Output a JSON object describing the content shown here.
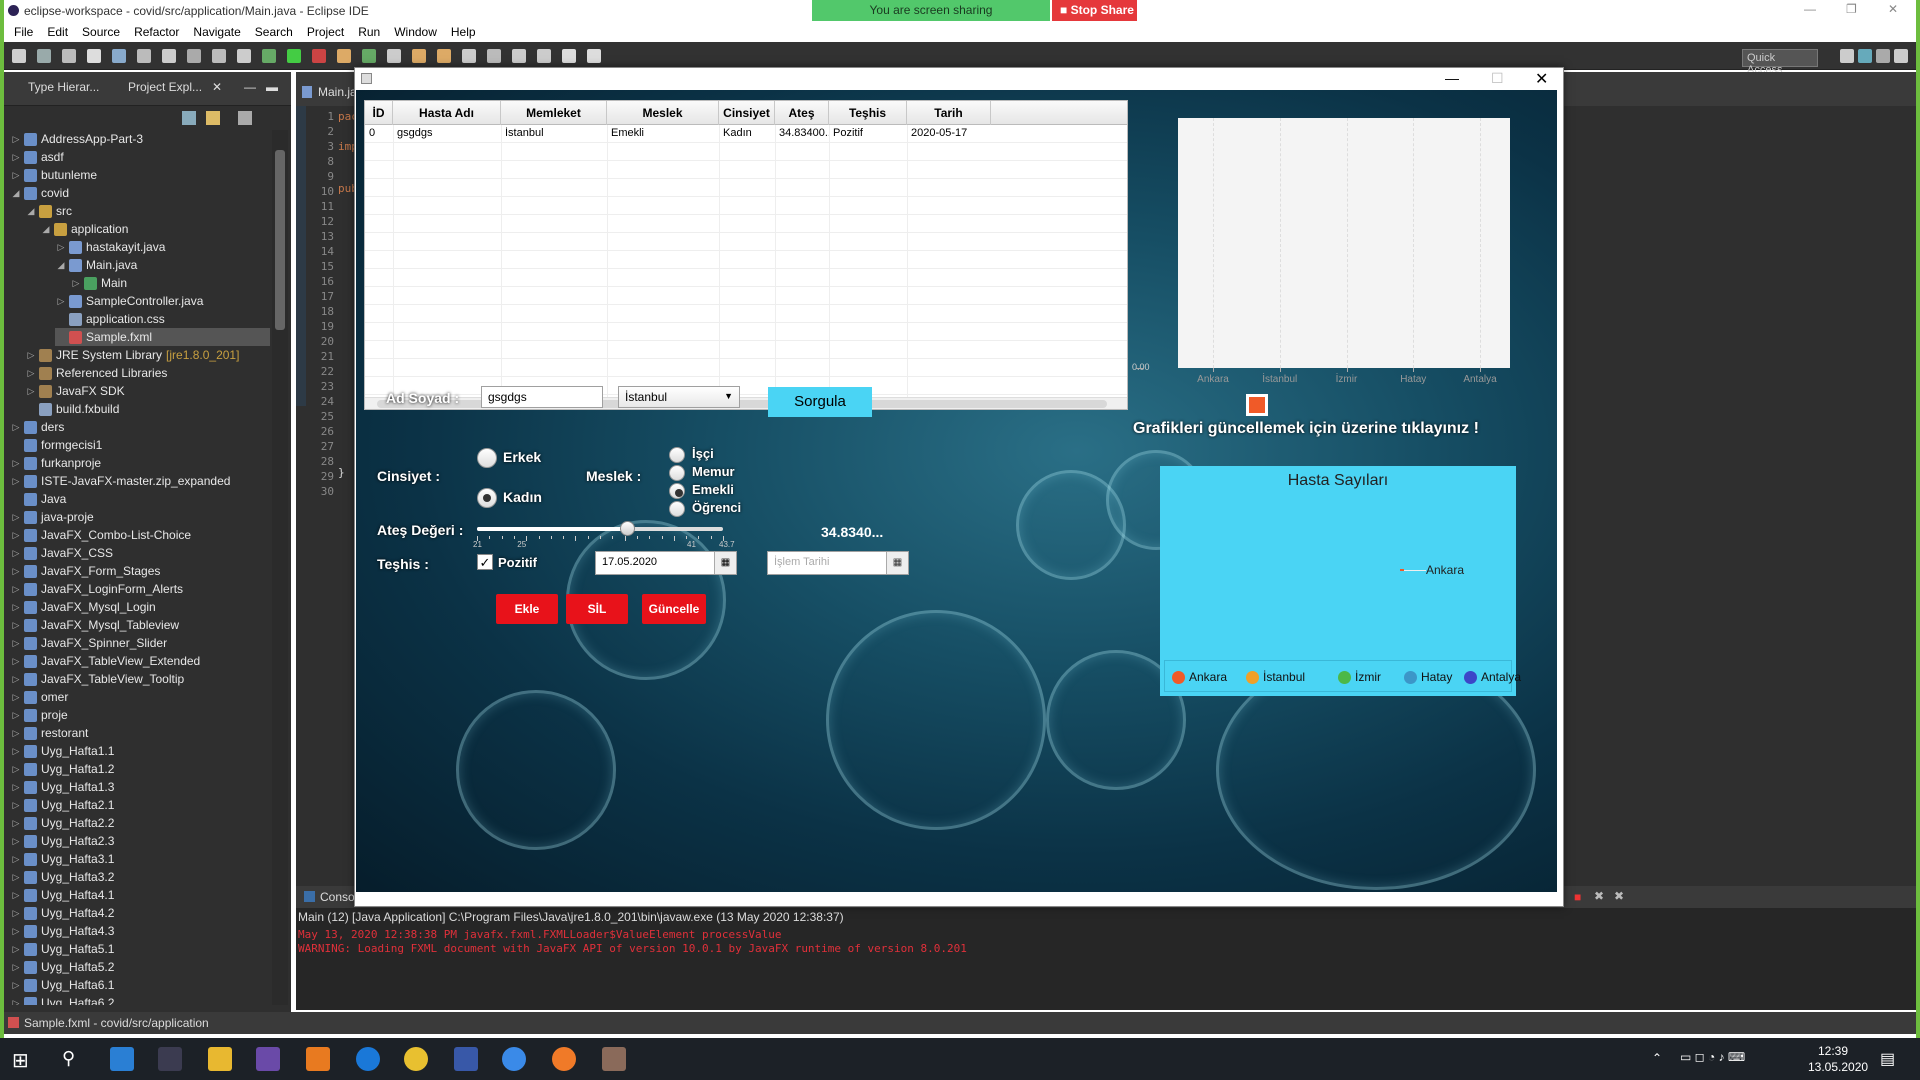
{
  "eclipse": {
    "title": "eclipse-workspace - covid/src/application/Main.java - Eclipse IDE",
    "menu": [
      "File",
      "Edit",
      "Source",
      "Refactor",
      "Navigate",
      "Search",
      "Project",
      "Run",
      "Window",
      "Help"
    ],
    "quick_access": "Quick Access",
    "share_text": "You are screen sharing",
    "stop_share": "Stop Share",
    "left_tabs": [
      "Type Hierar...",
      "Project Expl..."
    ],
    "editor_tab": "Main.ja",
    "tree": [
      {
        "label": "AddressApp-Part-3",
        "depth": 0,
        "arrow": "▷",
        "color": "#6a8fc8"
      },
      {
        "label": "asdf",
        "depth": 0,
        "arrow": "▷",
        "color": "#6a8fc8"
      },
      {
        "label": "butunleme",
        "depth": 0,
        "arrow": "▷",
        "color": "#6a8fc8"
      },
      {
        "label": "covid",
        "depth": 0,
        "arrow": "◢",
        "color": "#6a8fc8"
      },
      {
        "label": "src",
        "depth": 1,
        "arrow": "◢",
        "color": "#c8a040"
      },
      {
        "label": "application",
        "depth": 2,
        "arrow": "◢",
        "color": "#c8a040"
      },
      {
        "label": "hastakayit.java",
        "depth": 3,
        "arrow": "▷",
        "color": "#7a9ad0"
      },
      {
        "label": "Main.java",
        "depth": 3,
        "arrow": "◢",
        "color": "#7a9ad0"
      },
      {
        "label": "Main",
        "depth": 4,
        "arrow": "▷",
        "color": "#4aa060"
      },
      {
        "label": "SampleController.java",
        "depth": 3,
        "arrow": "▷",
        "color": "#7a9ad0"
      },
      {
        "label": "application.css",
        "depth": 3,
        "arrow": "",
        "color": "#8aa0c0"
      },
      {
        "label": "Sample.fxml",
        "depth": 3,
        "arrow": "",
        "color": "#d05050",
        "selected": true
      },
      {
        "label": "JRE System Library",
        "suffix": "[jre1.8.0_201]",
        "depth": 1,
        "arrow": "▷",
        "color": "#a08050"
      },
      {
        "label": "Referenced Libraries",
        "depth": 1,
        "arrow": "▷",
        "color": "#a08050"
      },
      {
        "label": "JavaFX SDK",
        "depth": 1,
        "arrow": "▷",
        "color": "#a08050"
      },
      {
        "label": "build.fxbuild",
        "depth": 1,
        "arrow": "",
        "color": "#8aa0c0"
      },
      {
        "label": "ders",
        "depth": 0,
        "arrow": "▷",
        "color": "#6a8fc8"
      },
      {
        "label": "formgecisi1",
        "depth": 0,
        "arrow": "",
        "color": "#6a8fc8"
      },
      {
        "label": "furkanproje",
        "depth": 0,
        "arrow": "▷",
        "color": "#6a8fc8"
      },
      {
        "label": "ISTE-JavaFX-master.zip_expanded",
        "depth": 0,
        "arrow": "▷",
        "color": "#6a8fc8"
      },
      {
        "label": "Java",
        "depth": 0,
        "arrow": "",
        "color": "#6a8fc8"
      },
      {
        "label": "java-proje",
        "depth": 0,
        "arrow": "▷",
        "color": "#6a8fc8"
      },
      {
        "label": "JavaFX_Combo-List-Choice",
        "depth": 0,
        "arrow": "▷",
        "color": "#6a8fc8"
      },
      {
        "label": "JavaFX_CSS",
        "depth": 0,
        "arrow": "▷",
        "color": "#6a8fc8"
      },
      {
        "label": "JavaFX_Form_Stages",
        "depth": 0,
        "arrow": "▷",
        "color": "#6a8fc8"
      },
      {
        "label": "JavaFX_LoginForm_Alerts",
        "depth": 0,
        "arrow": "▷",
        "color": "#6a8fc8"
      },
      {
        "label": "JavaFX_Mysql_Login",
        "depth": 0,
        "arrow": "▷",
        "color": "#6a8fc8"
      },
      {
        "label": "JavaFX_Mysql_Tableview",
        "depth": 0,
        "arrow": "▷",
        "color": "#6a8fc8"
      },
      {
        "label": "JavaFX_Spinner_Slider",
        "depth": 0,
        "arrow": "▷",
        "color": "#6a8fc8"
      },
      {
        "label": "JavaFX_TableView_Extended",
        "depth": 0,
        "arrow": "▷",
        "color": "#6a8fc8"
      },
      {
        "label": "JavaFX_TableView_Tooltip",
        "depth": 0,
        "arrow": "▷",
        "color": "#6a8fc8"
      },
      {
        "label": "omer",
        "depth": 0,
        "arrow": "▷",
        "color": "#6a8fc8"
      },
      {
        "label": "proje",
        "depth": 0,
        "arrow": "▷",
        "color": "#6a8fc8"
      },
      {
        "label": "restorant",
        "depth": 0,
        "arrow": "▷",
        "color": "#6a8fc8"
      },
      {
        "label": "Uyg_Hafta1.1",
        "depth": 0,
        "arrow": "▷",
        "color": "#6a8fc8"
      },
      {
        "label": "Uyg_Hafta1.2",
        "depth": 0,
        "arrow": "▷",
        "color": "#6a8fc8"
      },
      {
        "label": "Uyg_Hafta1.3",
        "depth": 0,
        "arrow": "▷",
        "color": "#6a8fc8"
      },
      {
        "label": "Uyg_Hafta2.1",
        "depth": 0,
        "arrow": "▷",
        "color": "#6a8fc8"
      },
      {
        "label": "Uyg_Hafta2.2",
        "depth": 0,
        "arrow": "▷",
        "color": "#6a8fc8"
      },
      {
        "label": "Uyg_Hafta2.3",
        "depth": 0,
        "arrow": "▷",
        "color": "#6a8fc8"
      },
      {
        "label": "Uyg_Hafta3.1",
        "depth": 0,
        "arrow": "▷",
        "color": "#6a8fc8"
      },
      {
        "label": "Uyg_Hafta3.2",
        "depth": 0,
        "arrow": "▷",
        "color": "#6a8fc8"
      },
      {
        "label": "Uyg_Hafta4.1",
        "depth": 0,
        "arrow": "▷",
        "color": "#6a8fc8"
      },
      {
        "label": "Uyg_Hafta4.2",
        "depth": 0,
        "arrow": "▷",
        "color": "#6a8fc8"
      },
      {
        "label": "Uyg_Hafta4.3",
        "depth": 0,
        "arrow": "▷",
        "color": "#6a8fc8"
      },
      {
        "label": "Uyg_Hafta5.1",
        "depth": 0,
        "arrow": "▷",
        "color": "#6a8fc8"
      },
      {
        "label": "Uyg_Hafta5.2",
        "depth": 0,
        "arrow": "▷",
        "color": "#6a8fc8"
      },
      {
        "label": "Uyg_Hafta6.1",
        "depth": 0,
        "arrow": "▷",
        "color": "#6a8fc8"
      },
      {
        "label": "Uyg_Hafta6.2",
        "depth": 0,
        "arrow": "▷",
        "color": "#6a8fc8"
      }
    ],
    "line_numbers": [
      "1",
      "2",
      "3",
      "8",
      "9",
      "10",
      "11",
      "12",
      "13",
      "14",
      "15",
      "16",
      "17",
      "18",
      "19",
      "20",
      "21",
      "22",
      "23",
      "24",
      "25",
      "26",
      "27",
      "28",
      "29",
      "30"
    ],
    "code_frags": {
      "l1": "pac",
      "l3": "imp",
      "l10": "pub",
      "l29": "}"
    },
    "console_tab": "Conso",
    "console_head": "Main (12) [Java Application] C:\\Program Files\\Java\\jre1.8.0_201\\bin\\javaw.exe (13 May 2020 12:38:37)",
    "console_lines": [
      "May 13, 2020 12:38:38 PM javafx.fxml.FXMLLoader$ValueElement processValue",
      "WARNING: Loading FXML document with JavaFX API of version 10.0.1 by JavaFX runtime of version 8.0.201"
    ],
    "status": "Sample.fxml - covid/src/application",
    "clock_time": "12:39",
    "clock_date": "13.05.2020"
  },
  "app": {
    "columns": [
      "İD",
      "Hasta Adı",
      "Memleket",
      "Meslek",
      "Cinsiyet",
      "Ateş",
      "Teşhis",
      "Tarih"
    ],
    "rows": [
      [
        "0",
        "gsgdgs",
        "İstanbul",
        "Emekli",
        "Kadın",
        "34.83400...",
        "Pozitif",
        "2020-05-17"
      ]
    ],
    "labels": {
      "ad_soyad": "Ad Soyad :",
      "cinsiyet": "Cinsiyet :",
      "meslek": "Meslek :",
      "ates": "Ateş Değeri :",
      "teshis": "Teşhis :"
    },
    "name_value": "gsgdgs",
    "city_value": "İstanbul",
    "query_button": "Sorgula",
    "gender": [
      {
        "label": "Erkek",
        "checked": false
      },
      {
        "label": "Kadın",
        "checked": true
      }
    ],
    "jobs": [
      {
        "label": "İşçi",
        "checked": false
      },
      {
        "label": "Memur",
        "checked": false
      },
      {
        "label": "Emekli",
        "checked": true
      },
      {
        "label": "Öğrenci",
        "checked": false
      }
    ],
    "slider": {
      "min": 21,
      "max": 43.7,
      "value": 34.834,
      "ticks": [
        "21",
        "25",
        "",
        "",
        "",
        "41",
        "43.7"
      ]
    },
    "ates_display": "34.8340...",
    "positive_label": "Pozitif",
    "positive_checked": true,
    "date_value": "17.05.2020",
    "process_date_placeholder": "İşlem Tarihi",
    "buttons": {
      "add": "Ekle",
      "delete": "SİL",
      "update": "Güncelle"
    },
    "chart_hint": "Grafikleri güncellemek için üzerine tıklayınız !",
    "colors": {
      "red": "#e8121a",
      "cyan": "#4ad4f4",
      "button_blue": "#4ad4f4"
    }
  },
  "chart_data": [
    {
      "type": "bar",
      "categories": [
        "Ankara",
        "İstanbul",
        "İzmir",
        "Hatay",
        "Antalya"
      ],
      "values": [
        0,
        0,
        0,
        0,
        0
      ],
      "y_tick": "0.00",
      "title": "",
      "legend_marker_color": "#f05a28"
    },
    {
      "type": "pie",
      "title": "Hasta Sayıları",
      "categories": [
        "Ankara",
        "İstanbul",
        "İzmir",
        "Hatay",
        "Antalya"
      ],
      "values": [
        1,
        0,
        0,
        0,
        0
      ],
      "slice_label": "Ankara",
      "legend": [
        {
          "name": "Ankara",
          "color": "#f05a28"
        },
        {
          "name": "İstanbul",
          "color": "#f0a028"
        },
        {
          "name": "İzmir",
          "color": "#4cb848"
        },
        {
          "name": "Hatay",
          "color": "#3c96c8"
        },
        {
          "name": "Antalya",
          "color": "#3c46c8"
        }
      ]
    }
  ]
}
